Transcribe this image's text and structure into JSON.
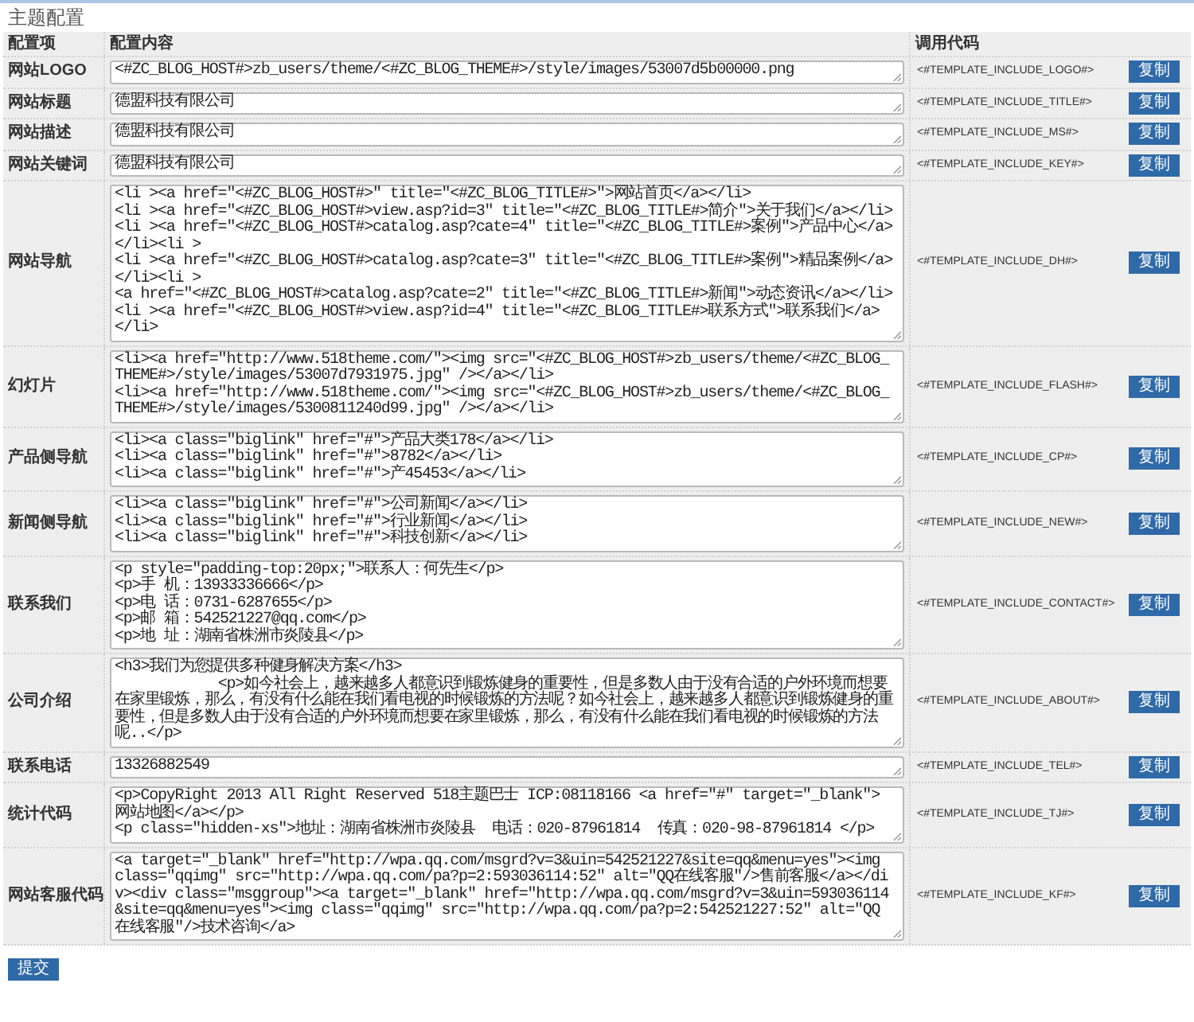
{
  "page": {
    "title": "主题配置"
  },
  "table": {
    "columns": [
      "配置项",
      "配置内容",
      "调用代码"
    ],
    "rows": [
      {
        "label": "网站LOGO",
        "value": "<#ZC_BLOG_HOST#>zb_users/theme/<#ZC_BLOG_THEME#>/style/images/53007d5b00000.png",
        "code": "<#TEMPLATE_INCLUDE_LOGO#>",
        "button": "复制"
      },
      {
        "label": "网站标题",
        "value": "德盟科技有限公司",
        "code": "<#TEMPLATE_INCLUDE_TITLE#>",
        "button": "复制"
      },
      {
        "label": "网站描述",
        "value": "德盟科技有限公司",
        "code": "<#TEMPLATE_INCLUDE_MS#>",
        "button": "复制"
      },
      {
        "label": "网站关键词",
        "value": "德盟科技有限公司",
        "code": "<#TEMPLATE_INCLUDE_KEY#>",
        "button": "复制"
      },
      {
        "label": "网站导航",
        "value": "<li ><a href=\"<#ZC_BLOG_HOST#>\" title=\"<#ZC_BLOG_TITLE#>\">网站首页</a></li>\n<li ><a href=\"<#ZC_BLOG_HOST#>view.asp?id=3\" title=\"<#ZC_BLOG_TITLE#>简介\">关于我们</a></li>\n<li ><a href=\"<#ZC_BLOG_HOST#>catalog.asp?cate=4\" title=\"<#ZC_BLOG_TITLE#>案例\">产品中心</a></li><li >\n<li ><a href=\"<#ZC_BLOG_HOST#>catalog.asp?cate=3\" title=\"<#ZC_BLOG_TITLE#>案例\">精品案例</a></li><li >\n<a href=\"<#ZC_BLOG_HOST#>catalog.asp?cate=2\" title=\"<#ZC_BLOG_TITLE#>新闻\">动态资讯</a></li>\n<li ><a href=\"<#ZC_BLOG_HOST#>view.asp?id=4\" title=\"<#ZC_BLOG_TITLE#>联系方式\">联系我们</a></li>",
        "code": "<#TEMPLATE_INCLUDE_DH#>",
        "button": "复制"
      },
      {
        "label": "幻灯片",
        "value": "<li><a href=\"http://www.518theme.com/\"><img src=\"<#ZC_BLOG_HOST#>zb_users/theme/<#ZC_BLOG_THEME#>/style/images/53007d7931975.jpg\" /></a></li>\n<li><a href=\"http://www.518theme.com/\"><img src=\"<#ZC_BLOG_HOST#>zb_users/theme/<#ZC_BLOG_THEME#>/style/images/5300811240d99.jpg\" /></a></li>",
        "code": "<#TEMPLATE_INCLUDE_FLASH#>",
        "button": "复制"
      },
      {
        "label": "产品侧导航",
        "value": "<li><a class=\"biglink\" href=\"#\">产品大类178</a></li>\n<li><a class=\"biglink\" href=\"#\">8782</a></li>\n<li><a class=\"biglink\" href=\"#\">产45453</a></li>",
        "code": "<#TEMPLATE_INCLUDE_CP#>",
        "button": "复制"
      },
      {
        "label": "新闻侧导航",
        "value": "<li><a class=\"biglink\" href=\"#\">公司新闻</a></li>\n<li><a class=\"biglink\" href=\"#\">行业新闻</a></li>\n<li><a class=\"biglink\" href=\"#\">科技创新</a></li>",
        "code": "<#TEMPLATE_INCLUDE_NEW#>",
        "button": "复制"
      },
      {
        "label": "联系我们",
        "value": "<p style=\"padding-top:20px;\">联系人：何先生</p>\n<p>手 机：13933336666</p>\n<p>电 话：0731-6287655</p>\n<p>邮 箱：542521227@qq.com</p>\n<p>地 址：湖南省株洲市炎陵县</p>",
        "code": "<#TEMPLATE_INCLUDE_CONTACT#>",
        "button": "复制"
      },
      {
        "label": "公司介绍",
        "value": "<h3>我们为您提供多种健身解决方案</h3>\n            <p>如今社会上，越来越多人都意识到锻炼健身的重要性，但是多数人由于没有合适的户外环境而想要在家里锻炼，那么，有没有什么能在我们看电视的时候锻炼的方法呢？如今社会上，越来越多人都意识到锻炼健身的重要性，但是多数人由于没有合适的户外环境而想要在家里锻炼，那么，有没有什么能在我们看电视的时候锻炼的方法呢..</p>",
        "code": "<#TEMPLATE_INCLUDE_ABOUT#>",
        "button": "复制"
      },
      {
        "label": "联系电话",
        "value": "13326882549",
        "code": "<#TEMPLATE_INCLUDE_TEL#>",
        "button": "复制"
      },
      {
        "label": "统计代码",
        "value": "<p>CopyRight 2013 All Right Reserved 518主题巴士 ICP:08118166 <a href=\"#\" target=\"_blank\">网站地图</a></p>\n<p class=\"hidden-xs\">地址：湖南省株洲市炎陵县  电话：020-87961814  传真：020-98-87961814 </p>",
        "code": "<#TEMPLATE_INCLUDE_TJ#>",
        "button": "复制"
      },
      {
        "label": "网站客服代码",
        "value": "<a target=\"_blank\" href=\"http://wpa.qq.com/msgrd?v=3&uin=542521227&site=qq&menu=yes\"><img class=\"qqimg\" src=\"http://wpa.qq.com/pa?p=2:593036114:52\" alt=\"QQ在线客服\"/>售前客服</a></div><div class=\"msggroup\"><a target=\"_blank\" href=\"http://wpa.qq.com/msgrd?v=3&uin=593036114&site=qq&menu=yes\"><img class=\"qqimg\" src=\"http://wpa.qq.com/pa?p=2:542521227:52\" alt=\"QQ在线客服\"/>技术咨询</a>",
        "code": "<#TEMPLATE_INCLUDE_KF#>",
        "button": "复制"
      }
    ]
  },
  "submit_button": "提交"
}
